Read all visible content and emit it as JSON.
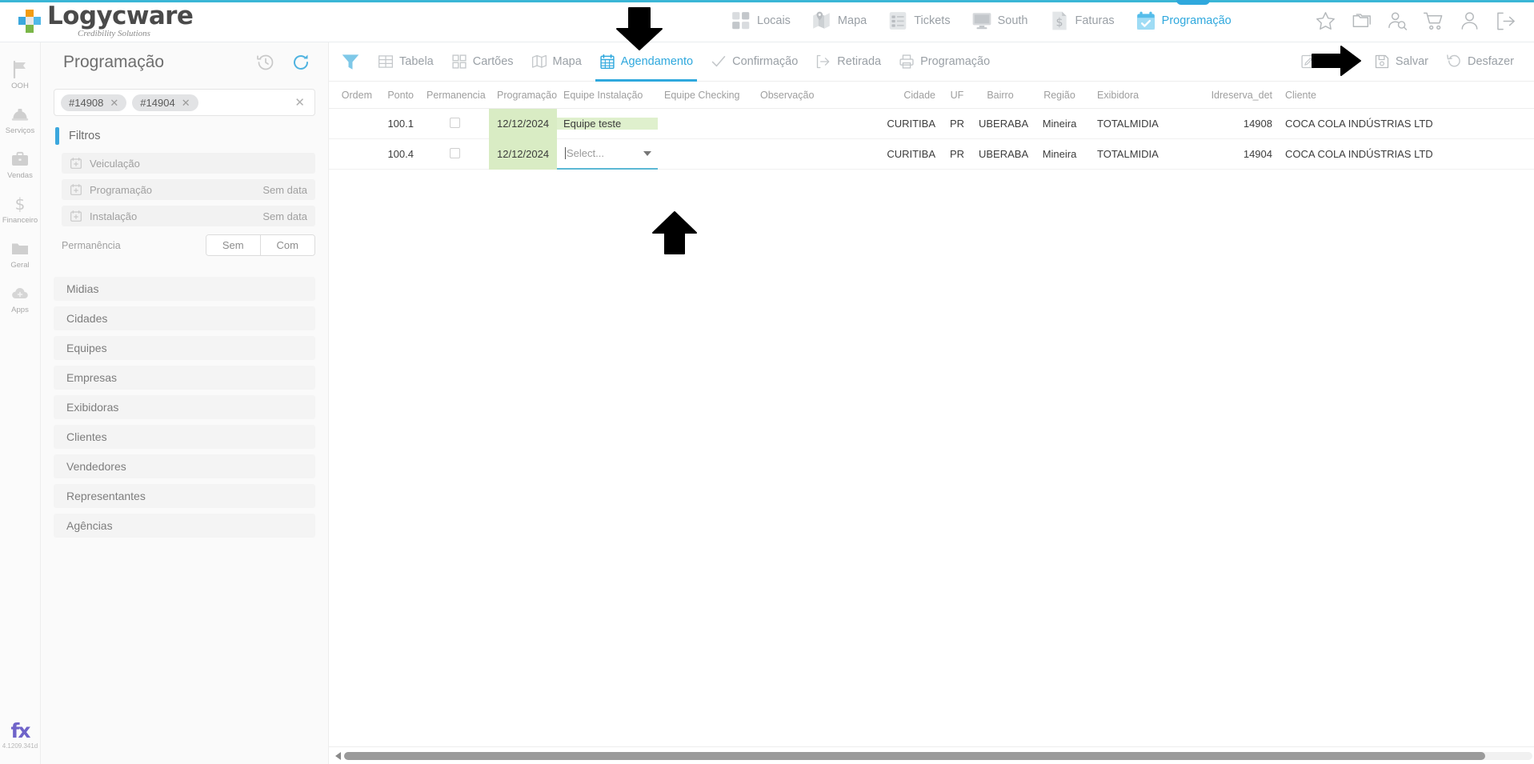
{
  "brand": {
    "name": "Logycware",
    "tagline": "Credibility Solutions"
  },
  "topnav": [
    {
      "label": "Locais",
      "icon": "grid-squares-icon",
      "active": false
    },
    {
      "label": "Mapa",
      "icon": "map-pin-icon",
      "active": false
    },
    {
      "label": "Tickets",
      "icon": "checklist-icon",
      "active": false
    },
    {
      "label": "South",
      "icon": "monitor-icon",
      "active": false
    },
    {
      "label": "Faturas",
      "icon": "invoice-dollar-icon",
      "active": false
    },
    {
      "label": "Programação",
      "icon": "calendar-check-icon",
      "active": true
    }
  ],
  "topicons": [
    {
      "name": "star-icon"
    },
    {
      "name": "folders-icon"
    },
    {
      "name": "user-search-icon"
    },
    {
      "name": "cart-icon"
    },
    {
      "name": "user-icon"
    },
    {
      "name": "logout-icon"
    }
  ],
  "rail": {
    "items": [
      {
        "label": "OOH",
        "icon": "flag-icon"
      },
      {
        "label": "Serviços",
        "icon": "hardhat-icon"
      },
      {
        "label": "Vendas",
        "icon": "briefcase-icon"
      },
      {
        "label": "Financeiro",
        "icon": "dollar-icon"
      },
      {
        "label": "Geral",
        "icon": "folder-icon"
      },
      {
        "label": "Apps",
        "icon": "cloud-plus-icon"
      }
    ],
    "version": "4.1209.341d",
    "logo_text": "fx"
  },
  "panel": {
    "title": "Programação",
    "actions": [
      {
        "name": "history-icon"
      },
      {
        "name": "refresh-icon"
      }
    ],
    "tags": [
      "#14908",
      "#14904"
    ],
    "tag_remove_label": "✕",
    "clear_all_label": "✕",
    "section_label": "Filtros",
    "filters": [
      {
        "label": "Veiculação",
        "value": ""
      },
      {
        "label": "Programação",
        "value": "Sem data"
      },
      {
        "label": "Instalação",
        "value": "Sem data"
      }
    ],
    "permanencia": {
      "label": "Permanência",
      "options": [
        "Sem",
        "Com"
      ]
    },
    "accordions": [
      "Midias",
      "Cidades",
      "Equipes",
      "Empresas",
      "Exibidoras",
      "Clientes",
      "Vendedores",
      "Representantes",
      "Agências"
    ]
  },
  "toolbar": {
    "funnel_icon": "filter-funnel-icon",
    "tabs": [
      {
        "label": "Tabela",
        "icon": "table-icon",
        "active": false
      },
      {
        "label": "Cartões",
        "icon": "cards-icon",
        "active": false
      },
      {
        "label": "Mapa",
        "icon": "map-icon",
        "active": false
      },
      {
        "label": "Agendamento",
        "icon": "calendar-grid-icon",
        "active": true
      },
      {
        "label": "Confirmação",
        "icon": "check-icon",
        "active": false
      },
      {
        "label": "Retirada",
        "icon": "exit-arrow-icon",
        "active": false
      },
      {
        "label": "Programação",
        "icon": "printer-icon",
        "active": false
      }
    ],
    "right_actions": [
      {
        "label": "Alterar",
        "icon": "edit-icon"
      },
      {
        "label": "Salvar",
        "icon": "save-disk-icon"
      },
      {
        "label": "Desfazer",
        "icon": "undo-icon"
      }
    ]
  },
  "table": {
    "columns": [
      "Ordem",
      "Ponto",
      "Permanencia",
      "Programação",
      "Equipe Instalação",
      "Equipe Checking",
      "Observação",
      "Cidade",
      "UF",
      "Bairro",
      "Região",
      "Exibidora",
      "Idreserva_det",
      "Cliente"
    ],
    "rows": [
      {
        "ordem": "",
        "ponto": "100.1",
        "permanencia": "",
        "programacao": "12/12/2024",
        "equipe_instalacao": "Equipe teste",
        "equipe_checking": "",
        "observacao": "",
        "cidade": "CURITIBA",
        "uf": "PR",
        "bairro": "UBERABA",
        "regiao": "Mineira",
        "exibidora": "TOTALMIDIA",
        "idreserva_det": "14908",
        "cliente": "COCA COLA INDÚSTRIAS LTD"
      },
      {
        "ordem": "",
        "ponto": "100.4",
        "permanencia": "",
        "programacao": "12/12/2024",
        "equipe_instalacao": "Select...",
        "equipe_checking": "",
        "observacao": "",
        "cidade": "CURITIBA",
        "uf": "PR",
        "bairro": "UBERABA",
        "regiao": "Mineira",
        "exibidora": "TOTALMIDIA",
        "idreserva_det": "14904",
        "cliente": "COCA COLA INDÚSTRIAS LTD"
      }
    ],
    "select_placeholder": "Select..."
  },
  "colors": {
    "accent": "#2fa8dd",
    "brand_dark": "#4a4a4a",
    "row_highlight": "#d9ecc4",
    "select_underline": "#5bb8d4",
    "muted": "#9aa0a6"
  }
}
